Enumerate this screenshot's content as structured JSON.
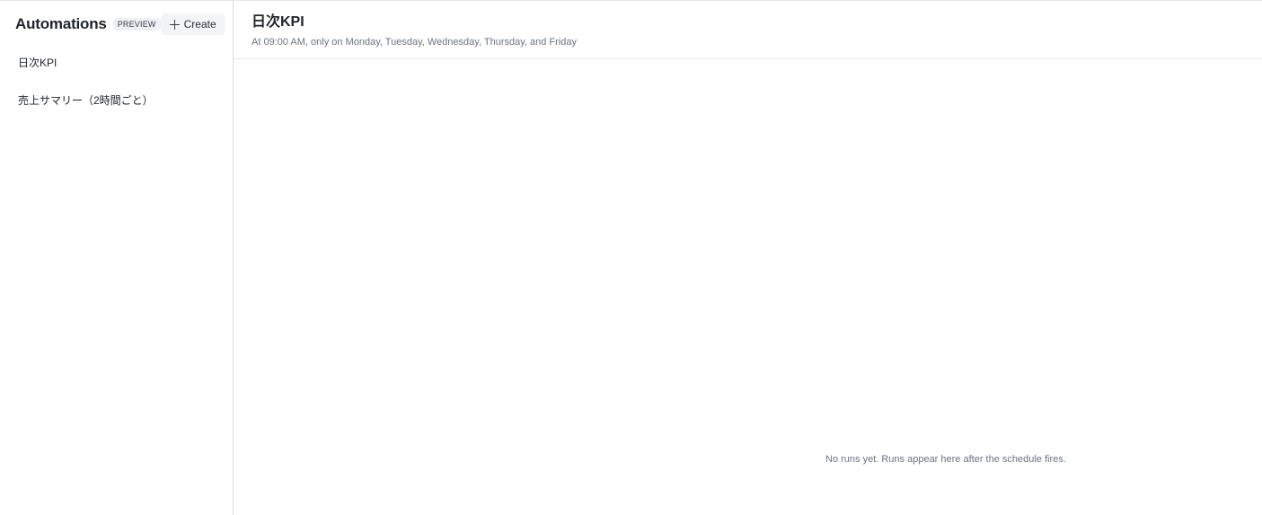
{
  "sidebar": {
    "title": "Automations",
    "badge": "PREVIEW",
    "create_label": "Create",
    "items": [
      {
        "label": "日次KPI"
      },
      {
        "label": "売上サマリー（2時間ごと）"
      }
    ]
  },
  "main": {
    "title": "日次KPI",
    "schedule": "At 09:00 AM, only on Monday, Tuesday, Wednesday, Thursday, and Friday",
    "empty_message": "No runs yet. Runs appear here after the schedule fires."
  },
  "icons": {
    "create": "plus-icon"
  }
}
